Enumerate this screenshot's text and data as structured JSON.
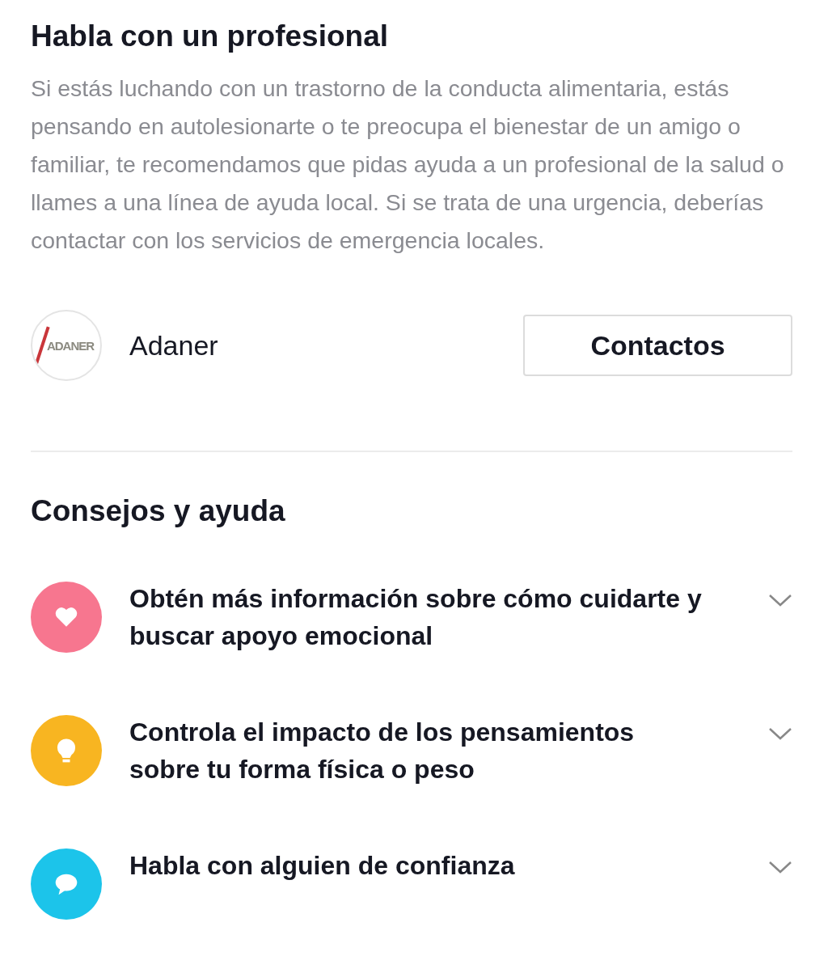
{
  "professional": {
    "title": "Habla con un profesional",
    "body": "Si estás luchando con un trastorno de la conducta alimentaria, estás pensando en autolesionarte o te preocupa el bienestar de un amigo o familiar, te recomendamos que pidas ayuda a un profesional de la salud o llames a una línea de ayuda local. Si se trata de una urgencia, deberías contactar con los servicios de emergencia locales.",
    "organization": {
      "logo_text": "ADANER",
      "name": "Adaner",
      "button": "Contactos"
    }
  },
  "tips": {
    "title": "Consejos y ayuda",
    "items": [
      {
        "kind": "heart",
        "color": "#f7768f",
        "label": "Obtén más información sobre cómo cuidarte y buscar apoyo emocional",
        "expanded": false
      },
      {
        "kind": "bulb",
        "color": "#f8b521",
        "label": "Controla el impacto de los pensamientos sobre tu forma física o peso",
        "expanded": false
      },
      {
        "kind": "chat",
        "color": "#1cc4ea",
        "label": "Habla con alguien de confianza",
        "expanded": false
      }
    ]
  }
}
